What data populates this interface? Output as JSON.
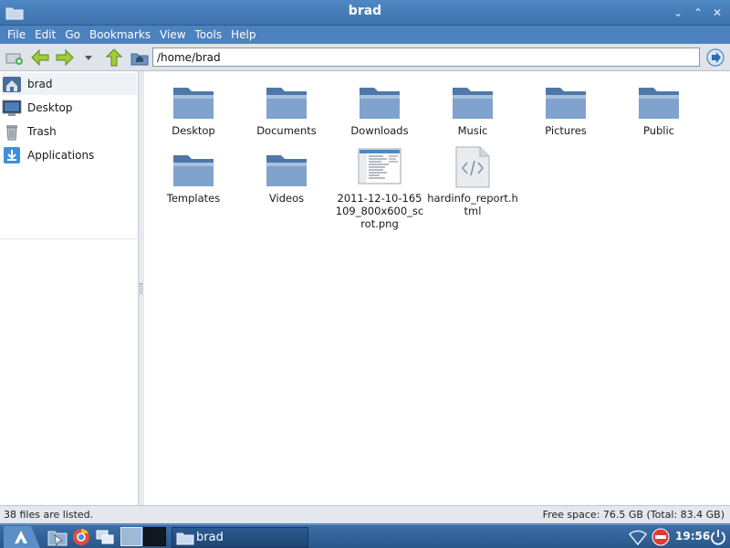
{
  "window": {
    "title": "brad",
    "controls": {
      "minimize": "⌄",
      "maximize": "⌃",
      "close": "✕"
    }
  },
  "menu": [
    "File",
    "Edit",
    "Go",
    "Bookmarks",
    "View",
    "Tools",
    "Help"
  ],
  "toolbar": {
    "path_value": "/home/brad",
    "icons": [
      "new-tab-icon",
      "back-arrow-icon",
      "forward-arrow-icon",
      "history-dropdown-icon",
      "up-arrow-icon",
      "home-folder-icon",
      "go-icon"
    ]
  },
  "sidebar": {
    "items": [
      {
        "label": "brad",
        "icon": "home-icon"
      },
      {
        "label": "Desktop",
        "icon": "desktop-icon"
      },
      {
        "label": "Trash",
        "icon": "trash-icon"
      },
      {
        "label": "Applications",
        "icon": "applications-icon"
      }
    ]
  },
  "files": [
    {
      "label": "Desktop",
      "icon": "folder-icon"
    },
    {
      "label": "Documents",
      "icon": "folder-icon"
    },
    {
      "label": "Downloads",
      "icon": "folder-icon"
    },
    {
      "label": "Music",
      "icon": "folder-icon"
    },
    {
      "label": "Pictures",
      "icon": "folder-icon"
    },
    {
      "label": "Public",
      "icon": "folder-icon"
    },
    {
      "label": "Templates",
      "icon": "folder-icon"
    },
    {
      "label": "Videos",
      "icon": "folder-icon"
    },
    {
      "label": "2011-12-10-165109_800x600_scrot.png",
      "icon": "image-thumbnail-icon"
    },
    {
      "label": "hardinfo_report.html",
      "icon": "html-file-icon"
    }
  ],
  "status": {
    "left": "38 files are listed.",
    "right": "Free space: 76.5 GB (Total: 83.4 GB)"
  },
  "taskbar": {
    "window_label": "brad",
    "clock": "19:56",
    "icons": [
      "start-menu-icon",
      "file-manager-launcher-icon",
      "browser-icon",
      "window-switcher-icon",
      "workspace-1-icon",
      "workspace-2-icon",
      "network-icon",
      "stop-icon",
      "power-icon"
    ]
  },
  "colors": {
    "accent": "#4a7fb8",
    "folder": "#5b86b5",
    "toolbar": "#dfe4ea"
  }
}
